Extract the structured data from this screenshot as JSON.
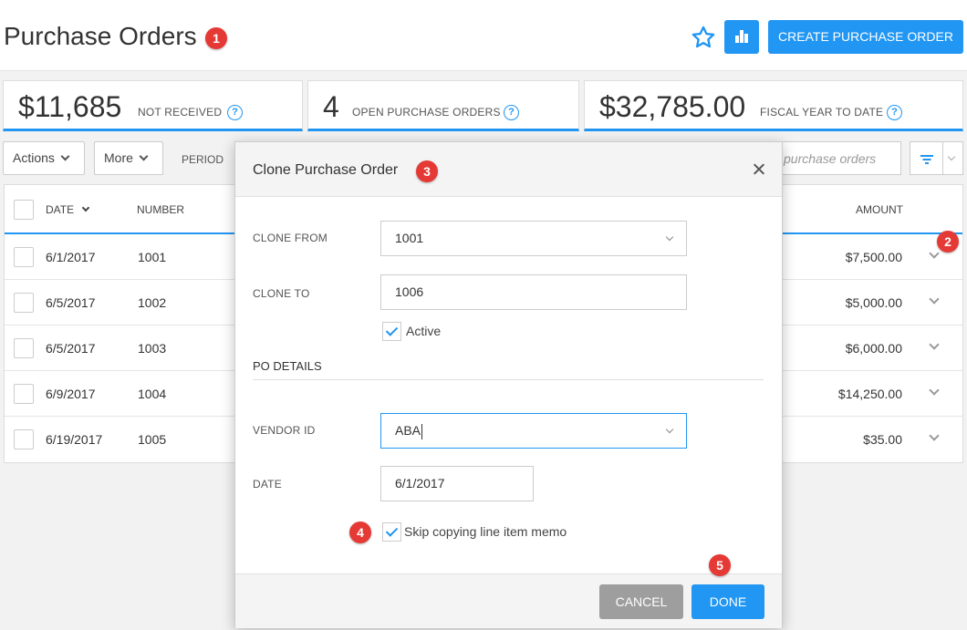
{
  "header": {
    "title": "Purchase Orders",
    "create_label": "CREATE PURCHASE ORDER"
  },
  "badges": [
    "1",
    "2",
    "3",
    "4",
    "5"
  ],
  "stats": [
    {
      "value": "$11,685",
      "label": "NOT RECEIVED"
    },
    {
      "value": "4",
      "label": "OPEN PURCHASE ORDERS"
    },
    {
      "value": "$32,785.00",
      "label": "FISCAL YEAR TO DATE"
    }
  ],
  "toolbar": {
    "actions_label": "Actions",
    "more_label": "More",
    "period_label": "PERIOD",
    "search_placeholder": "purchase orders"
  },
  "table": {
    "columns": {
      "date": "DATE",
      "number": "NUMBER",
      "amount": "AMOUNT"
    },
    "rows": [
      {
        "date": "6/1/2017",
        "number": "1001",
        "amount": "$7,500.00"
      },
      {
        "date": "6/5/2017",
        "number": "1002",
        "amount": "$5,000.00"
      },
      {
        "date": "6/5/2017",
        "number": "1003",
        "amount": "$6,000.00"
      },
      {
        "date": "6/9/2017",
        "number": "1004",
        "amount": "$14,250.00"
      },
      {
        "date": "6/19/2017",
        "number": "1005",
        "amount": "$35.00"
      }
    ]
  },
  "modal": {
    "title": "Clone Purchase Order",
    "clone_from_label": "CLONE FROM",
    "clone_from_value": "1001",
    "clone_to_label": "CLONE TO",
    "clone_to_value": "1006",
    "active_label": "Active",
    "section_title": "PO DETAILS",
    "vendor_label": "VENDOR ID",
    "vendor_value": "ABA",
    "date_label": "DATE",
    "date_value": "6/1/2017",
    "skip_memo_label": "Skip copying line item memo",
    "cancel_label": "CANCEL",
    "done_label": "DONE"
  },
  "colors": {
    "accent": "#2196f3",
    "badge": "#e53935",
    "cancel": "#9e9e9e"
  }
}
